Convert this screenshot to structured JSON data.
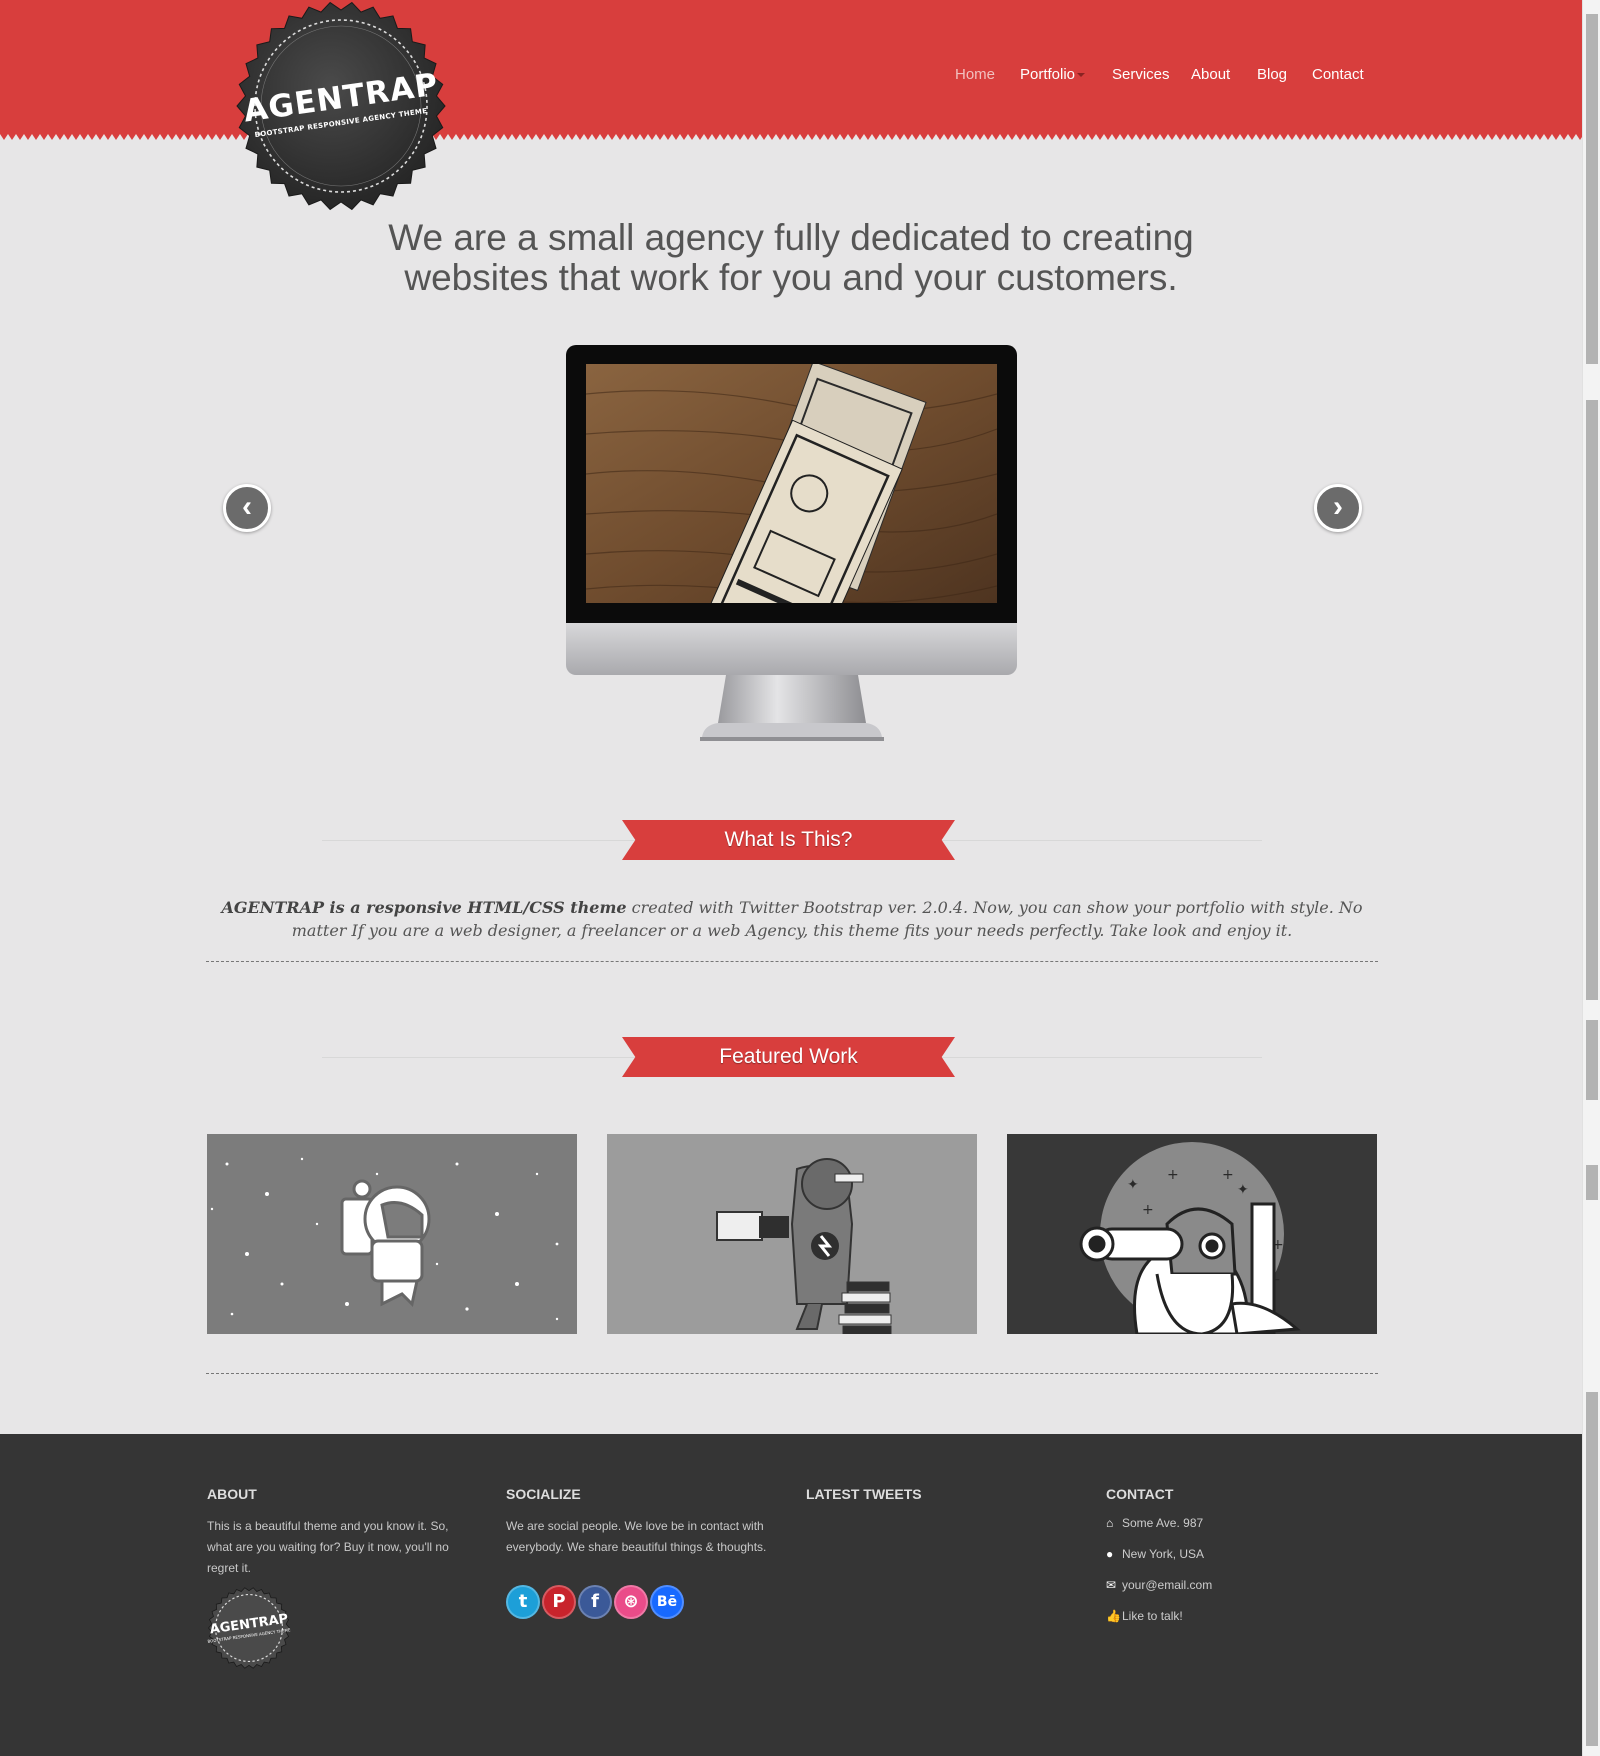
{
  "brand": {
    "name": "AGENTRAP",
    "tagline": "BOOTSTRAP RESPONSIVE AGENCY THEME",
    "accent": "#d83e3d",
    "footer_bg": "#353535",
    "page_bg": "#e7e6e7"
  },
  "nav": {
    "items": [
      {
        "label": "Home",
        "active": true
      },
      {
        "label": "Portfolio",
        "has_dropdown": true
      },
      {
        "label": "Services"
      },
      {
        "label": "About"
      },
      {
        "label": "Blog"
      },
      {
        "label": "Contact"
      }
    ]
  },
  "hero": {
    "line1": "We are a small agency fully dedicated to creating",
    "line2": "websites that work for you and your customers.",
    "prev_icon": "chevron-left-icon",
    "next_icon": "chevron-right-icon",
    "prev_glyph": "‹",
    "next_glyph": "›"
  },
  "what_is_this": {
    "title": "What Is This?",
    "bold": "AGENTRAP is a responsive HTML/CSS theme",
    "text_rest": " created with Twitter Bootstrap ver. 2.0.4. Now, you can show your portfolio with style. No matter If you are a web designer, a freelancer or a web Agency, this theme fits your needs perfectly. Take look and enjoy it."
  },
  "featured": {
    "title": "Featured Work"
  },
  "footer": {
    "about": {
      "title": "ABOUT",
      "text": "This is a beautiful theme and you know it. So, what are you waiting for? Buy it now, you'll no regret it."
    },
    "socialize": {
      "title": "SOCIALIZE",
      "text": "We are social people. We love be in contact with everybody. We share beautiful things & thoughts.",
      "icons": [
        {
          "name": "twitter-icon",
          "color": "#1d9fd8",
          "glyph": "t"
        },
        {
          "name": "pinterest-icon",
          "color": "#c8232c",
          "glyph": "P"
        },
        {
          "name": "facebook-icon",
          "color": "#3b5998",
          "glyph": "f"
        },
        {
          "name": "dribbble-icon",
          "color": "#ea4c89",
          "glyph": "⊛"
        },
        {
          "name": "behance-icon",
          "color": "#1769ff",
          "glyph": "Bē"
        }
      ]
    },
    "tweets": {
      "title": "LATEST TWEETS"
    },
    "contact": {
      "title": "CONTACT",
      "address": "Some Ave. 987",
      "city": "New York, USA",
      "email": "your@email.com",
      "talk": "Like to talk!",
      "icons": {
        "address": "⌂",
        "city": "●",
        "email": "✉",
        "talk": "👍"
      }
    }
  }
}
